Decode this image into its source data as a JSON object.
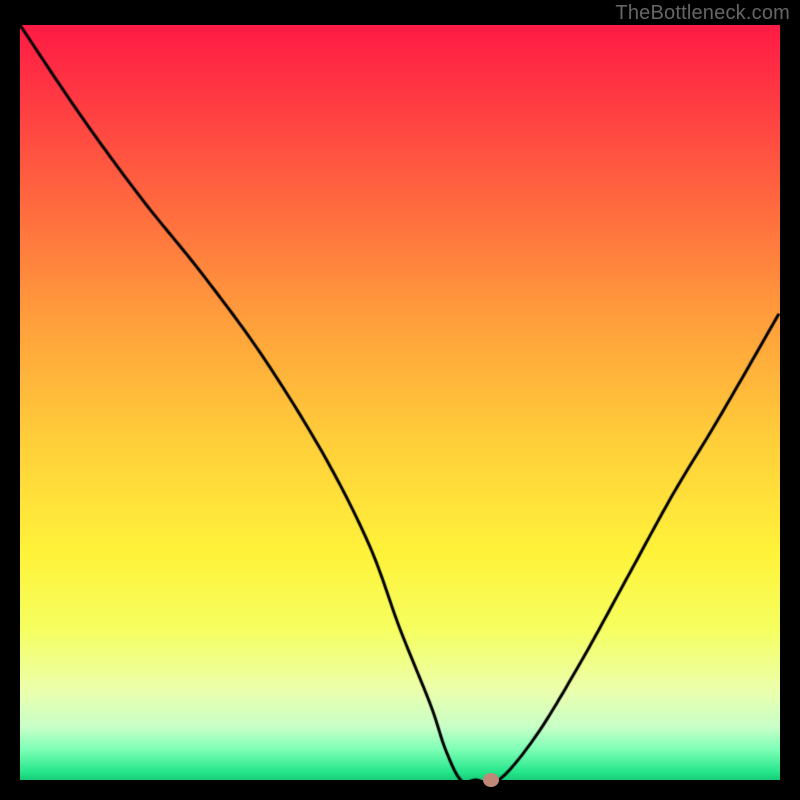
{
  "watermark": "TheBottleneck.com",
  "chart_data": {
    "type": "line",
    "title": "",
    "xlabel": "",
    "ylabel": "",
    "xlim": [
      0,
      100
    ],
    "ylim": [
      0,
      100
    ],
    "series": [
      {
        "name": "bottleneck-curve",
        "x": [
          0,
          8,
          16,
          24,
          32,
          40,
          46,
          50,
          54,
          56,
          58,
          60,
          63,
          68,
          74,
          80,
          86,
          92,
          100
        ],
        "values": [
          100,
          88,
          77,
          67,
          56,
          43,
          31,
          20,
          10,
          4,
          0,
          0,
          0,
          6,
          16,
          27,
          38,
          48,
          62
        ]
      }
    ],
    "marker": {
      "x": 62,
      "y": 0,
      "color": "#c08878"
    },
    "background_gradient": {
      "stops": [
        {
          "pos": 0.0,
          "color": "#ff1b45"
        },
        {
          "pos": 0.1,
          "color": "#ff3b43"
        },
        {
          "pos": 0.25,
          "color": "#ff6e3f"
        },
        {
          "pos": 0.4,
          "color": "#ffa23c"
        },
        {
          "pos": 0.55,
          "color": "#ffce3a"
        },
        {
          "pos": 0.7,
          "color": "#fff33a"
        },
        {
          "pos": 0.8,
          "color": "#f6ff60"
        },
        {
          "pos": 0.88,
          "color": "#ecffac"
        },
        {
          "pos": 0.93,
          "color": "#c8ffc8"
        },
        {
          "pos": 0.96,
          "color": "#7dffb6"
        },
        {
          "pos": 0.99,
          "color": "#24e68a"
        },
        {
          "pos": 1.0,
          "color": "#18cc78"
        }
      ]
    }
  }
}
